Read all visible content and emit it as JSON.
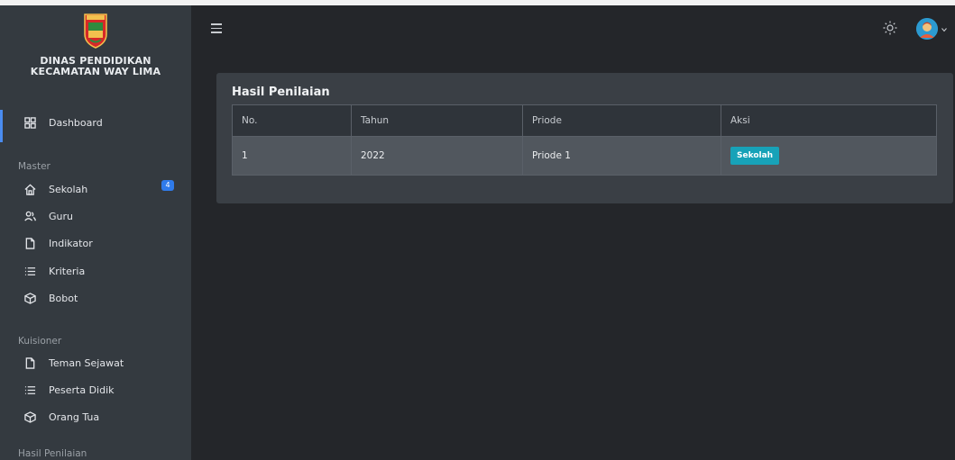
{
  "brand": {
    "line1": "DINAS PENDIDIKAN",
    "line2": "KECAMATAN WAY LIMA",
    "logo_text": "PESAWARAN"
  },
  "sidebar": {
    "items": [
      {
        "label": "Dashboard",
        "icon": "grid-icon"
      },
      {
        "label": "Sekolah",
        "icon": "home-icon",
        "badge": "4"
      },
      {
        "label": "Guru",
        "icon": "users-icon"
      },
      {
        "label": "Indikator",
        "icon": "file-icon"
      },
      {
        "label": "Kriteria",
        "icon": "list-icon"
      },
      {
        "label": "Bobot",
        "icon": "box-icon"
      },
      {
        "label": "Teman Sejawat",
        "icon": "file-icon"
      },
      {
        "label": "Peserta Didik",
        "icon": "list-icon"
      },
      {
        "label": "Orang Tua",
        "icon": "box-icon"
      }
    ],
    "sections": {
      "master": "Master",
      "kuisioner": "Kuisioner",
      "hasil": "Hasil Penilaian"
    }
  },
  "topbar": {
    "menu_icon": "hamburger-icon",
    "theme_icon": "sun-icon",
    "avatar_icon": "user-avatar"
  },
  "main": {
    "title": "Hasil Penilaian",
    "table": {
      "headers": [
        "No.",
        "Tahun",
        "Priode",
        "Aksi"
      ],
      "rows": [
        {
          "no": "1",
          "tahun": "2022",
          "priode": "Priode 1",
          "action": "Sekolah"
        }
      ]
    }
  },
  "colors": {
    "sidebar_bg": "#343a40",
    "content_bg": "#24262a",
    "card_bg": "#3a3f45",
    "accent_blue": "#2f7bea",
    "button_teal": "#17a2b8"
  }
}
